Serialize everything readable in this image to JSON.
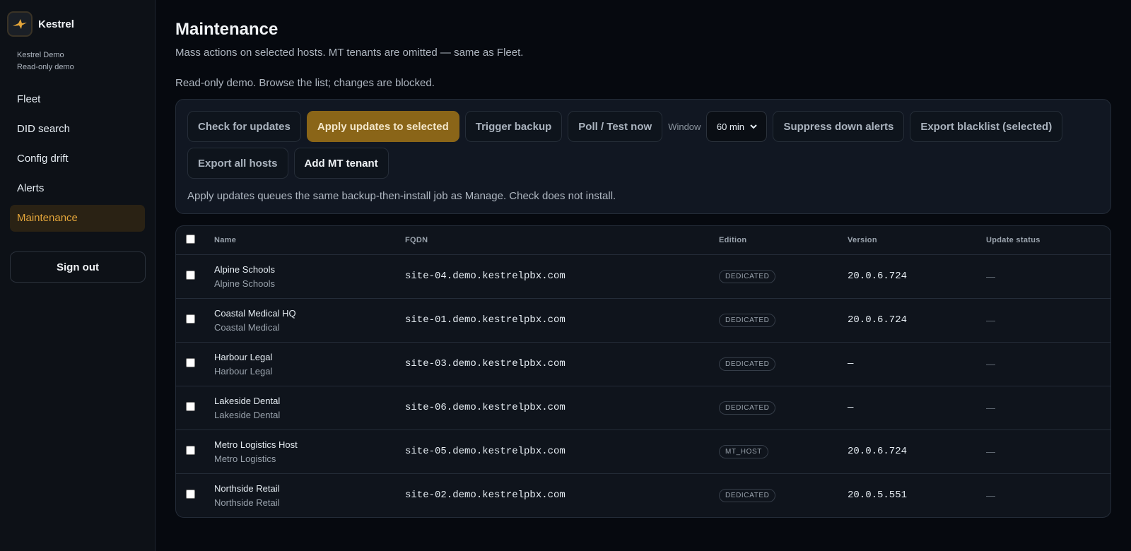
{
  "brand": {
    "name": "Kestrel",
    "org_line1": "Kestrel Demo",
    "org_line2": "Read-only demo"
  },
  "nav": [
    {
      "label": "Fleet"
    },
    {
      "label": "DID search"
    },
    {
      "label": "Config drift"
    },
    {
      "label": "Alerts"
    },
    {
      "label": "Maintenance"
    }
  ],
  "signout_label": "Sign out",
  "page": {
    "title": "Maintenance",
    "subtitle": "Mass actions on selected hosts. MT tenants are omitted — same as Fleet.",
    "notice": "Read-only demo. Browse the list; changes are blocked."
  },
  "actions": {
    "check": "Check for updates",
    "apply": "Apply updates to selected",
    "backup": "Trigger backup",
    "poll": "Poll / Test now",
    "window_label": "Window",
    "window_value": "60 min",
    "suppress": "Suppress down alerts",
    "export_blacklist": "Export blacklist (selected)",
    "export_all": "Export all hosts",
    "add_mt": "Add MT tenant",
    "hint": "Apply updates queues the same backup-then-install job as Manage. Check does not install."
  },
  "table": {
    "headers": {
      "name": "Name",
      "fqdn": "FQDN",
      "edition": "Edition",
      "version": "Version",
      "status": "Update status"
    },
    "rows": [
      {
        "name": "Alpine Schools",
        "org": "Alpine Schools",
        "fqdn": "site-04.demo.kestrelpbx.com",
        "edition": "DEDICATED",
        "version": "20.0.6.724",
        "status": "—"
      },
      {
        "name": "Coastal Medical HQ",
        "org": "Coastal Medical",
        "fqdn": "site-01.demo.kestrelpbx.com",
        "edition": "DEDICATED",
        "version": "20.0.6.724",
        "status": "—"
      },
      {
        "name": "Harbour Legal",
        "org": "Harbour Legal",
        "fqdn": "site-03.demo.kestrelpbx.com",
        "edition": "DEDICATED",
        "version": "—",
        "status": "—"
      },
      {
        "name": "Lakeside Dental",
        "org": "Lakeside Dental",
        "fqdn": "site-06.demo.kestrelpbx.com",
        "edition": "DEDICATED",
        "version": "—",
        "status": "—"
      },
      {
        "name": "Metro Logistics Host",
        "org": "Metro Logistics",
        "fqdn": "site-05.demo.kestrelpbx.com",
        "edition": "MT_HOST",
        "version": "20.0.6.724",
        "status": "—"
      },
      {
        "name": "Northside Retail",
        "org": "Northside Retail",
        "fqdn": "site-02.demo.kestrelpbx.com",
        "edition": "DEDICATED",
        "version": "20.0.5.551",
        "status": "—"
      }
    ]
  },
  "colors": {
    "accent": "#e3a53a",
    "primary_button": "#8a6518",
    "background": "#06090f"
  }
}
